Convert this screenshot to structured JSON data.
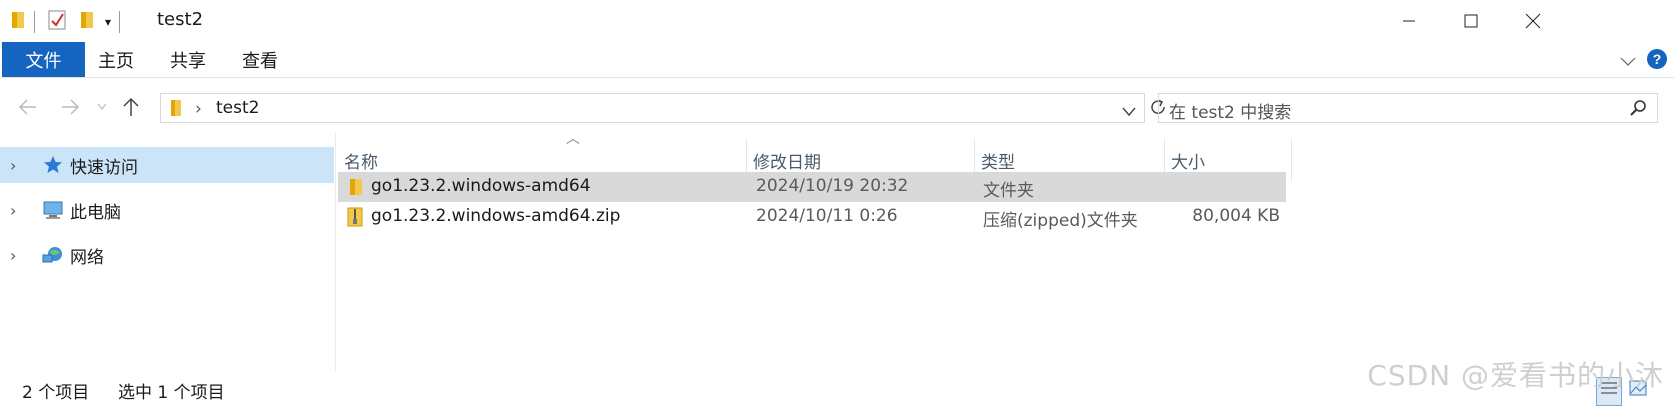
{
  "window": {
    "title": "test2"
  },
  "ribbon": {
    "tabs": [
      "文件",
      "主页",
      "共享",
      "查看"
    ]
  },
  "address": {
    "crumb": "test2"
  },
  "search": {
    "placeholder": "在 test2 中搜索"
  },
  "nav": {
    "items": [
      {
        "label": "快速访问",
        "icon": "star-icon",
        "selected": true
      },
      {
        "label": "此电脑",
        "icon": "computer-icon",
        "selected": false
      },
      {
        "label": "网络",
        "icon": "network-icon",
        "selected": false
      }
    ]
  },
  "filelist": {
    "columns": [
      "名称",
      "修改日期",
      "类型",
      "大小"
    ],
    "rows": [
      {
        "name": "go1.23.2.windows-amd64",
        "date": "2024/10/19 20:32",
        "type": "文件夹",
        "size": "",
        "icon": "folder-icon",
        "selected": true
      },
      {
        "name": "go1.23.2.windows-amd64.zip",
        "date": "2024/10/11 0:26",
        "type": "压缩(zipped)文件夹",
        "size": "80,004 KB",
        "icon": "zip-folder-icon",
        "selected": false
      }
    ]
  },
  "status": {
    "count": "2 个项目",
    "selected": "选中 1 个项目"
  },
  "watermark": "CSDN @爱看书的小沐",
  "colors": {
    "accent": "#1565c0",
    "selection": "#cce4f7",
    "row_selected": "#d9d9d9",
    "folder": "#f2c94c"
  }
}
